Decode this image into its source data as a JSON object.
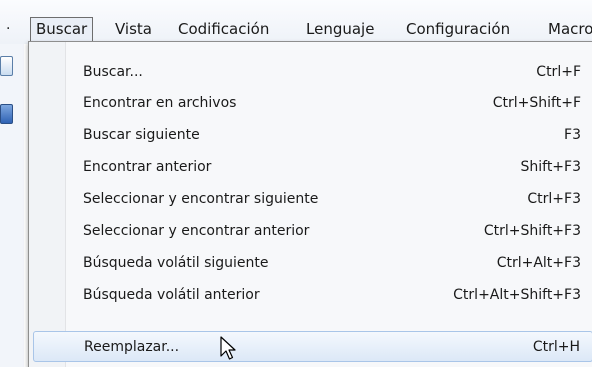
{
  "menubar": {
    "left_stub": "·",
    "items": [
      {
        "label": "Buscar",
        "active": true
      },
      {
        "label": "Vista"
      },
      {
        "label": "Codificación"
      },
      {
        "label": "Lenguaje"
      },
      {
        "label": "Configuración"
      },
      {
        "label": "Macro"
      }
    ]
  },
  "toolbar": {
    "icons": [
      "document-icon",
      "save-icon"
    ]
  },
  "dropdown": {
    "items": [
      {
        "label": "Buscar...",
        "shortcut": "Ctrl+F"
      },
      {
        "label": "Encontrar en archivos",
        "shortcut": "Ctrl+Shift+F"
      },
      {
        "label": "Buscar siguiente",
        "shortcut": "F3"
      },
      {
        "label": "Encontrar anterior",
        "shortcut": "Shift+F3"
      },
      {
        "label": "Seleccionar y encontrar siguiente",
        "shortcut": "Ctrl+F3"
      },
      {
        "label": "Seleccionar y encontrar anterior",
        "shortcut": "Ctrl+Shift+F3"
      },
      {
        "label": "Búsqueda volátil siguiente",
        "shortcut": "Ctrl+Alt+F3"
      },
      {
        "label": "Búsqueda volátil anterior",
        "shortcut": "Ctrl+Alt+Shift+F3"
      },
      {
        "label": "Reemplazar...",
        "shortcut": "Ctrl+H",
        "highlighted": true
      }
    ]
  },
  "colors": {
    "highlight_border": "#a9c5e8",
    "menu_background": "#f7f8fa",
    "text": "#1a1a1a"
  }
}
